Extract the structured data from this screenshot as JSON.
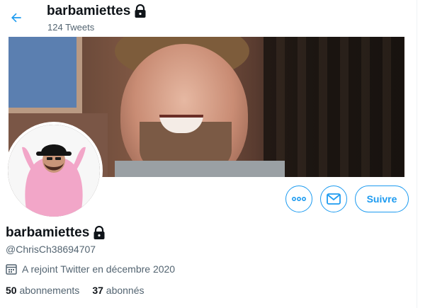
{
  "header": {
    "title": "barbamiettes",
    "tweet_count": "124 Tweets",
    "back_icon": "arrow-left-icon",
    "lock_icon": "lock-icon"
  },
  "banner": {
    "description_icon": "profile-banner-image"
  },
  "avatar": {
    "icon": "profile-avatar-image"
  },
  "actions": {
    "more_icon": "more-dots-icon",
    "message_icon": "envelope-icon",
    "follow_label": "Suivre"
  },
  "profile": {
    "display_name": "barbamiettes",
    "handle": "@ChrisCh38694707",
    "joined": "A rejoint Twitter en décembre 2020",
    "joined_icon": "calendar-icon",
    "following_count": "50",
    "following_label": "abonnements",
    "followers_count": "37",
    "followers_label": "abonnés"
  },
  "colors": {
    "accent": "#1d9bf0",
    "secondary_text": "#536471",
    "primary_text": "#0f1419"
  }
}
